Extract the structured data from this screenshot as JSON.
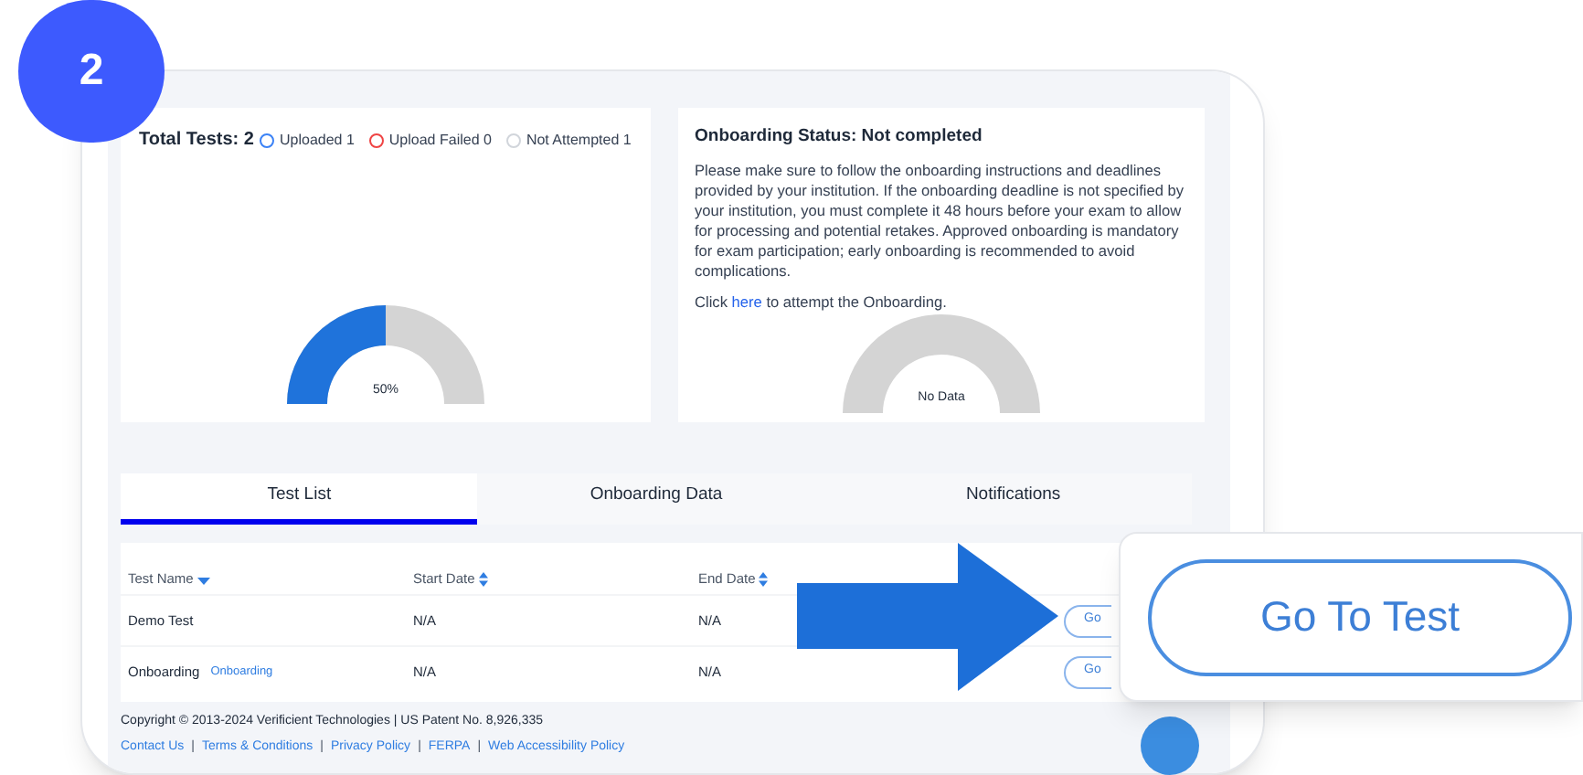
{
  "step_badge": "2",
  "tests_card": {
    "title": "Total Tests: 2",
    "legend": [
      {
        "label": "Uploaded 1",
        "color": "#3b82f6"
      },
      {
        "label": "Upload Failed 0",
        "color": "#ef4444"
      },
      {
        "label": "Not Attempted 1",
        "color": "#d1d5db"
      }
    ],
    "gauge": {
      "level": 0.5,
      "label": "50%"
    }
  },
  "onboarding_card": {
    "title": "Onboarding Status: Not completed",
    "text": "Please make sure to follow the onboarding instructions and deadlines provided by your institution. If the onboarding deadline is not specified by your institution, you must complete it 48 hours before your exam to allow for processing and potential retakes. Approved onboarding is mandatory for exam participation; early onboarding is recommended to avoid complications.",
    "link_before": "Click",
    "link": "here",
    "link_after": "to attempt the Onboarding.",
    "gauge": {
      "label": "No Data"
    }
  },
  "tabs": [
    {
      "label": "Test List",
      "selected": true
    },
    {
      "label": "Onboarding Data",
      "selected": false
    },
    {
      "label": "Notifications",
      "selected": false
    }
  ],
  "table": {
    "columns": [
      {
        "label": "Test Name",
        "kind": "desc"
      },
      {
        "label": "Start Date",
        "kind": "both"
      },
      {
        "label": "End Date",
        "kind": "both"
      }
    ],
    "rows": [
      {
        "name": "Demo Test",
        "start": "N/A",
        "end": "N/A",
        "button": "Go"
      },
      {
        "name": "Onboarding",
        "tag": "Onboarding",
        "start": "N/A",
        "end": "N/A",
        "button": "Go"
      }
    ]
  },
  "footer": {
    "copyright": "Copyright © 2013-2024 Verificient Technologies | US Patent No. 8,926,335",
    "separator": "|",
    "links": [
      "Contact Us",
      "Terms & Conditions",
      "Privacy Policy",
      "FERPA",
      "Web Accessibility Policy"
    ]
  },
  "callout": {
    "button": "Go To Test"
  }
}
